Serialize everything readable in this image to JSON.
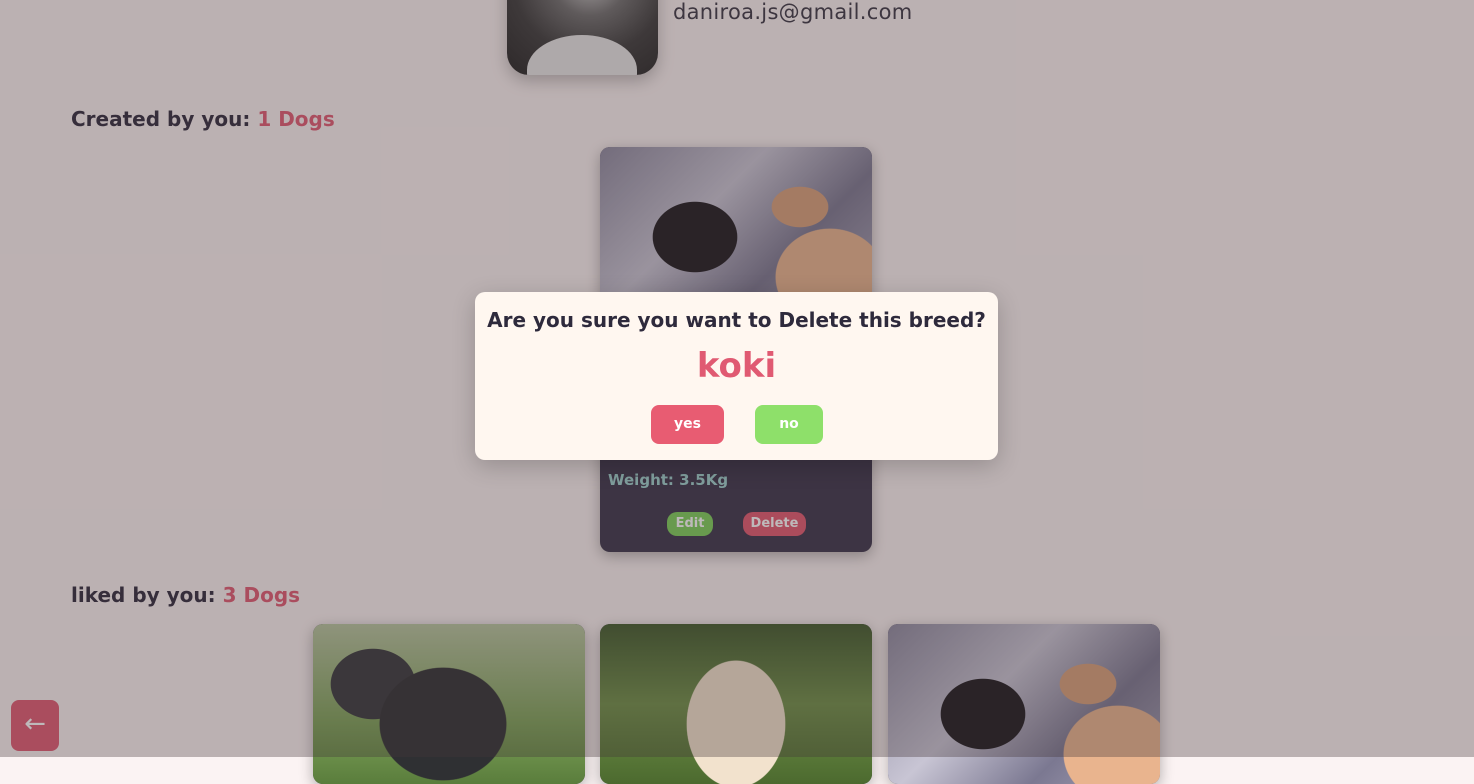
{
  "profile": {
    "email": "daniroa.js@gmail.com"
  },
  "created_section": {
    "label": "Created by you:",
    "count": "1 Dogs",
    "card": {
      "weight": "Weight: 3.5Kg",
      "edit_label": "Edit",
      "delete_label": "Delete"
    }
  },
  "liked_section": {
    "label": "liked by you:",
    "count": "3 Dogs"
  },
  "back_button": {
    "icon": "arrow-left-icon",
    "glyph": "←"
  },
  "modal": {
    "question": "Are you sure you want to Delete this breed?",
    "breed_name": "koki",
    "yes_label": "yes",
    "no_label": "no"
  },
  "colors": {
    "accent": "#e05a72",
    "confirm_yes": "#e85c72",
    "confirm_no": "#8ee06a",
    "card_bg": "#39344a"
  }
}
